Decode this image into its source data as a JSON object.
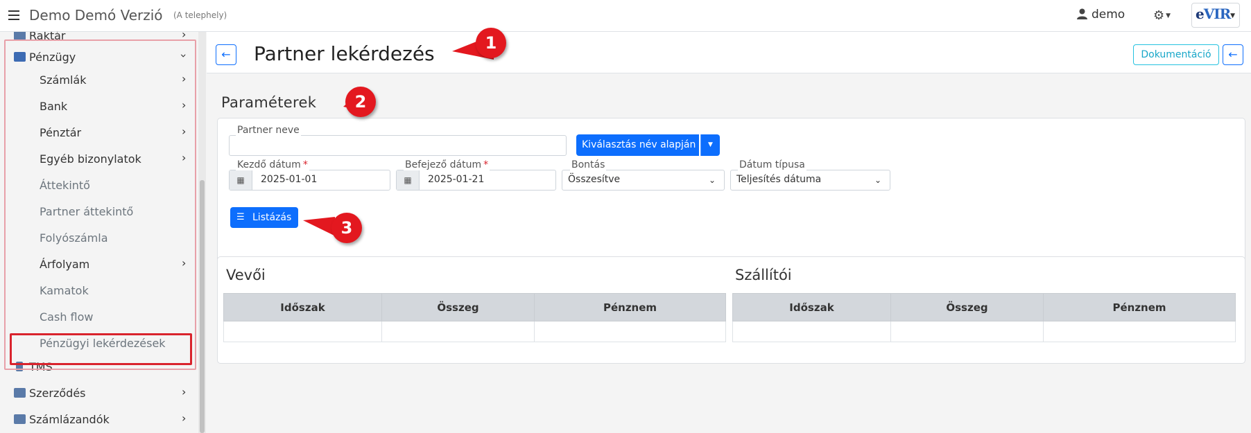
{
  "app": {
    "title": "Demo Demó Verzió",
    "subtitle": "(A telephely)"
  },
  "topbar": {
    "user_name": "demo",
    "logo_text": "eVIR"
  },
  "sidebar": {
    "partial_top": "Raktár",
    "group": "Pénzügy",
    "items": [
      {
        "label": "Számlák",
        "arrow": true
      },
      {
        "label": "Bank",
        "arrow": true
      },
      {
        "label": "Pénztár",
        "arrow": true
      },
      {
        "label": "Egyéb bizonylatok",
        "arrow": true
      },
      {
        "label": "Áttekintő",
        "arrow": false
      },
      {
        "label": "Partner áttekintő",
        "arrow": false
      },
      {
        "label": "Folyószámla",
        "arrow": false
      },
      {
        "label": "Árfolyam",
        "arrow": true
      },
      {
        "label": "Kamatok",
        "arrow": false
      },
      {
        "label": "Cash flow",
        "arrow": false
      },
      {
        "label": "Pénzügyi lekérdezések",
        "arrow": false
      }
    ],
    "after": [
      {
        "label": "TMS"
      },
      {
        "label": "Szerződés"
      },
      {
        "label": "Számlázandók"
      }
    ]
  },
  "header": {
    "title": "Partner lekérdezés",
    "doc_button": "Dokumentáció"
  },
  "params": {
    "title": "Paraméterek",
    "partner_label": "Partner neve",
    "partner_value": "",
    "select_button": "Kiválasztás név alapján",
    "start_label": "Kezdő dátum",
    "start_value": "2025-01-01",
    "end_label": "Befejező dátum",
    "end_value": "2025-01-21",
    "split_label": "Bontás",
    "split_value": "Összesítve",
    "datetype_label": "Dátum típusa",
    "datetype_value": "Teljesítés dátuma",
    "list_button": "Listázás"
  },
  "tables": {
    "customer_title": "Vevői",
    "supplier_title": "Szállítói",
    "columns": [
      "Időszak",
      "Összeg",
      "Pénznem"
    ]
  },
  "callouts": [
    "1",
    "2",
    "3"
  ],
  "colors": {
    "primary": "#0d6efd",
    "annotation": "#e3181f",
    "info": "#17a6c8"
  }
}
